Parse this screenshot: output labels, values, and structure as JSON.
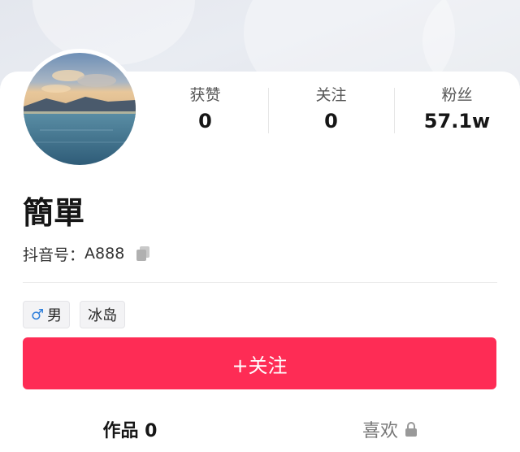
{
  "profile": {
    "nickname": "簡單",
    "douyin_id_label": "抖音号：",
    "douyin_id": "A888"
  },
  "stats": [
    {
      "label": "获赞",
      "value": "0"
    },
    {
      "label": "关注",
      "value": "0"
    },
    {
      "label": "粉丝",
      "value": "57.1w"
    }
  ],
  "tags": {
    "gender_symbol": "♂",
    "gender": "男",
    "location": "冰岛"
  },
  "follow_button": {
    "label": "+关注"
  },
  "tabs": {
    "works_label": "作品 0",
    "likes_label": "喜欢"
  },
  "colors": {
    "accent": "#fe2c55",
    "male_icon": "#2f7fdb"
  },
  "icons": [
    "copy-icon",
    "lock-icon",
    "male-icon"
  ]
}
